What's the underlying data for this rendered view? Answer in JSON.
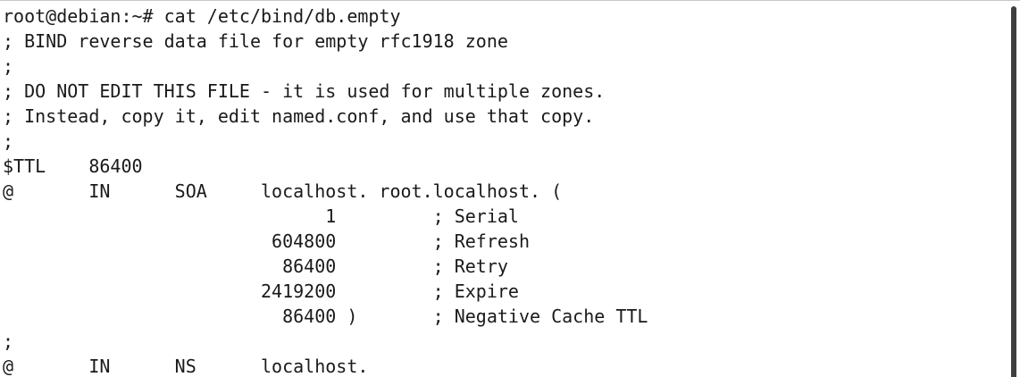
{
  "terminal": {
    "lines": [
      "root@debian:~# cat /etc/bind/db.empty",
      "; BIND reverse data file for empty rfc1918 zone",
      ";",
      "; DO NOT EDIT THIS FILE - it is used for multiple zones.",
      "; Instead, copy it, edit named.conf, and use that copy.",
      ";",
      "$TTL    86400",
      "@       IN      SOA     localhost. root.localhost. (",
      "                              1         ; Serial",
      "                         604800         ; Refresh",
      "                          86400         ; Retry",
      "                        2419200         ; Expire",
      "                          86400 )       ; Negative Cache TTL",
      ";",
      "@       IN      NS      localhost."
    ]
  }
}
